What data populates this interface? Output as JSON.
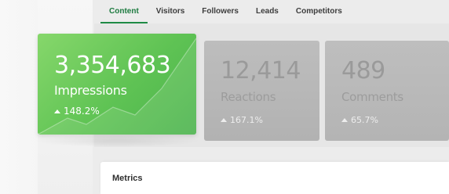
{
  "tabs": [
    {
      "label": "Content",
      "active": true
    },
    {
      "label": "Visitors",
      "active": false
    },
    {
      "label": "Followers",
      "active": false
    },
    {
      "label": "Leads",
      "active": false
    },
    {
      "label": "Competitors",
      "active": false
    }
  ],
  "cards": [
    {
      "value": "3,354,683",
      "label": "Impressions",
      "change": "148.2%",
      "trend": "up",
      "highlighted": true
    },
    {
      "value": "12,414",
      "label": "Reactions",
      "change": "167.1%",
      "trend": "up",
      "highlighted": false
    },
    {
      "value": "489",
      "label": "Comments",
      "change": "65.7%",
      "trend": "up",
      "highlighted": false
    }
  ],
  "metrics": {
    "title": "Metrics"
  },
  "colors": {
    "accent": "#1f8a45",
    "card_green": "#5fc354",
    "card_gray": "#b8b8b8"
  }
}
